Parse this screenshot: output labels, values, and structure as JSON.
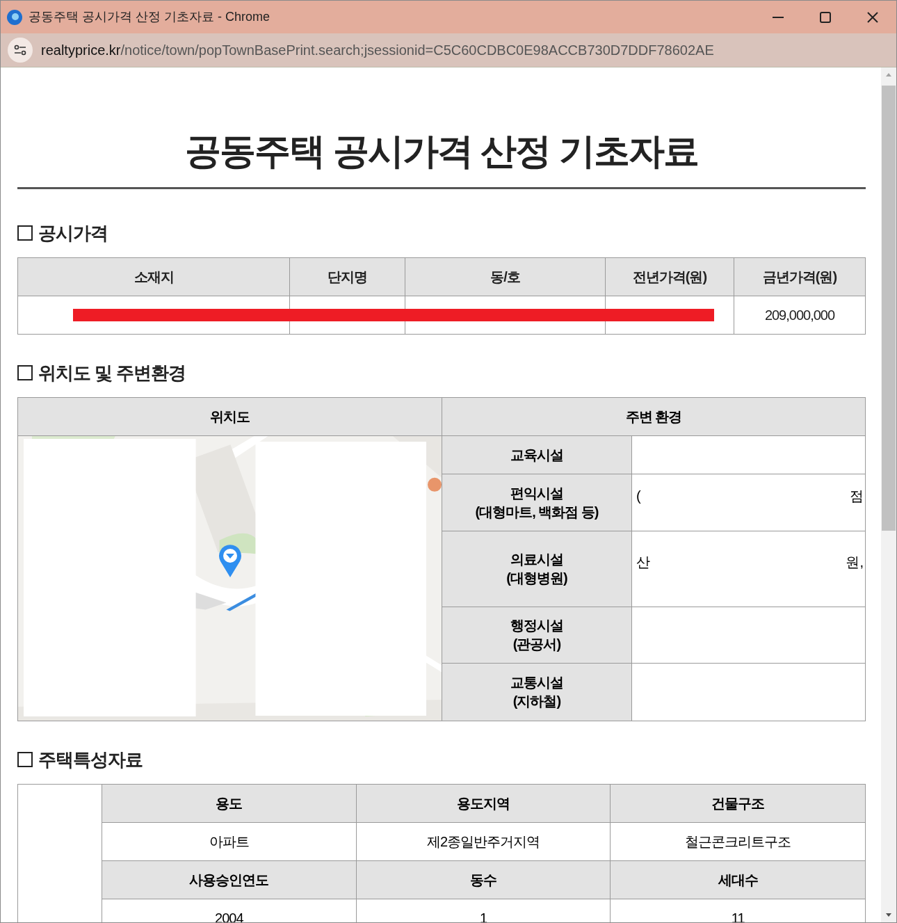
{
  "window": {
    "title": "공동주택 공시가격 산정 기초자료 - Chrome",
    "url_host": "realtyprice.kr",
    "url_path": "/notice/town/popTownBasePrint.search;jsessionid=C5C60CDBC0E98ACCB730D7DDF78602AE"
  },
  "doc_title": "공동주택 공시가격 산정 기초자료",
  "price_section": {
    "heading": "공시가격",
    "columns": [
      "소재지",
      "단지명",
      "동/호",
      "전년가격(원)",
      "금년가격(원)"
    ],
    "row": [
      {
        "kind": "redacted"
      },
      {
        "kind": "redacted"
      },
      {
        "kind": "redacted"
      },
      {
        "kind": "redacted"
      },
      {
        "kind": "text",
        "text": "209,000,000"
      }
    ]
  },
  "location_section": {
    "heading": "위치도 및 주변환경",
    "map_heading": "위치도",
    "env_heading": "주변 환경",
    "env_rows": [
      {
        "label": "교육시설"
      },
      {
        "label": "편익시설\n(대형마트, 백화점 등)",
        "left": "(",
        "right": "점"
      },
      {
        "label": "의료시설\n(대형병원)",
        "left": "산",
        "right": "원,"
      },
      {
        "label": "행정시설\n(관공서)"
      },
      {
        "label": "교통시설\n(지하철)"
      }
    ]
  },
  "housing_section": {
    "heading": "주택특성자료",
    "rows": [
      {
        "kind": "header",
        "cells": [
          "용도",
          "용도지역",
          "건물구조"
        ]
      },
      {
        "kind": "value",
        "cells": [
          "아파트",
          "제2종일반주거지역",
          "철근콘크리트구조"
        ]
      },
      {
        "kind": "header",
        "cells": [
          "사용승인연도",
          "동수",
          "세대수"
        ]
      },
      {
        "kind": "value",
        "cells": [
          "2004",
          "1",
          "11"
        ]
      }
    ]
  }
}
